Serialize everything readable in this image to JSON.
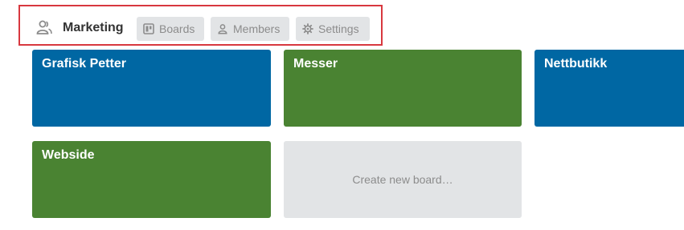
{
  "team": {
    "name": "Marketing",
    "icon": "team-icon"
  },
  "tabs": [
    {
      "label": "Boards",
      "icon": "board-icon"
    },
    {
      "label": "Members",
      "icon": "person-icon"
    },
    {
      "label": "Settings",
      "icon": "gear-icon"
    }
  ],
  "boards": [
    {
      "title": "Grafisk Petter",
      "color": "#0067a3"
    },
    {
      "title": "Messer",
      "color": "#4a8332"
    },
    {
      "title": "Nettbutikk",
      "color": "#0067a3"
    },
    {
      "title": "Webside",
      "color": "#4a8332"
    }
  ],
  "create_board": {
    "label": "Create new board…"
  },
  "colors": {
    "highlight_border": "#d8383f",
    "tab_background": "#e2e4e6",
    "muted_text": "#8c8c8c"
  }
}
